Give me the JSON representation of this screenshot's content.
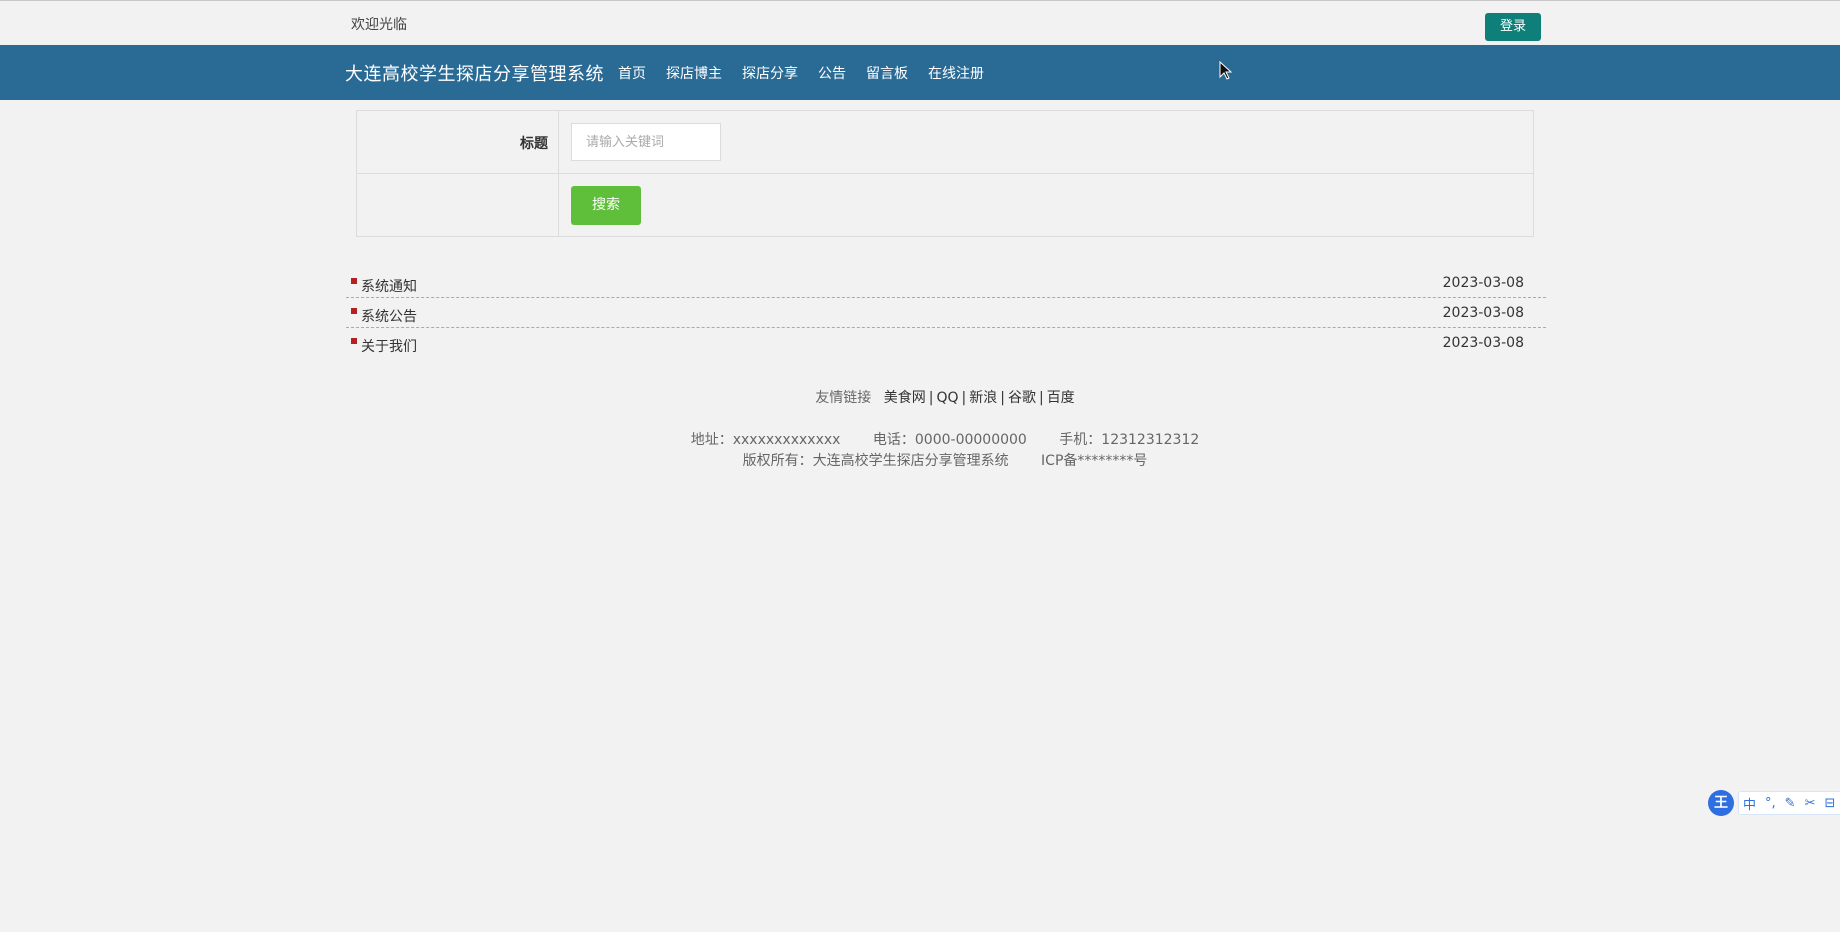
{
  "topbar": {
    "welcome": "欢迎光临",
    "login_label": "登录"
  },
  "nav": {
    "site_title": "大连高校学生探店分享管理系统",
    "links": [
      "首页",
      "探店博主",
      "探店分享",
      "公告",
      "留言板",
      "在线注册"
    ]
  },
  "search": {
    "title_label": "标题",
    "placeholder": "请输入关键词",
    "button_label": "搜索"
  },
  "notices": [
    {
      "title": "系统通知",
      "date": "2023-03-08"
    },
    {
      "title": "系统公告",
      "date": "2023-03-08"
    },
    {
      "title": "关于我们",
      "date": "2023-03-08"
    }
  ],
  "footer": {
    "friend_label": "友情链接",
    "friend_links": [
      "美食网",
      "QQ",
      "新浪",
      "谷歌",
      "百度"
    ],
    "address": "地址：xxxxxxxxxxxxx",
    "phone": "电话：0000-00000000",
    "mobile": "手机：12312312312",
    "copyright": "版权所有：大连高校学生探店分享管理系统",
    "icp": "ICP备********号"
  },
  "ime": {
    "logo": "王",
    "items": [
      "中",
      "°,",
      "✎",
      "✂",
      "⊟"
    ]
  },
  "colors": {
    "nav_bg": "#2a6b96",
    "login_btn": "#0f7f7a",
    "search_btn": "#5fbf3b",
    "bullet": "#b22222",
    "page_bg": "#f2f2f2"
  }
}
